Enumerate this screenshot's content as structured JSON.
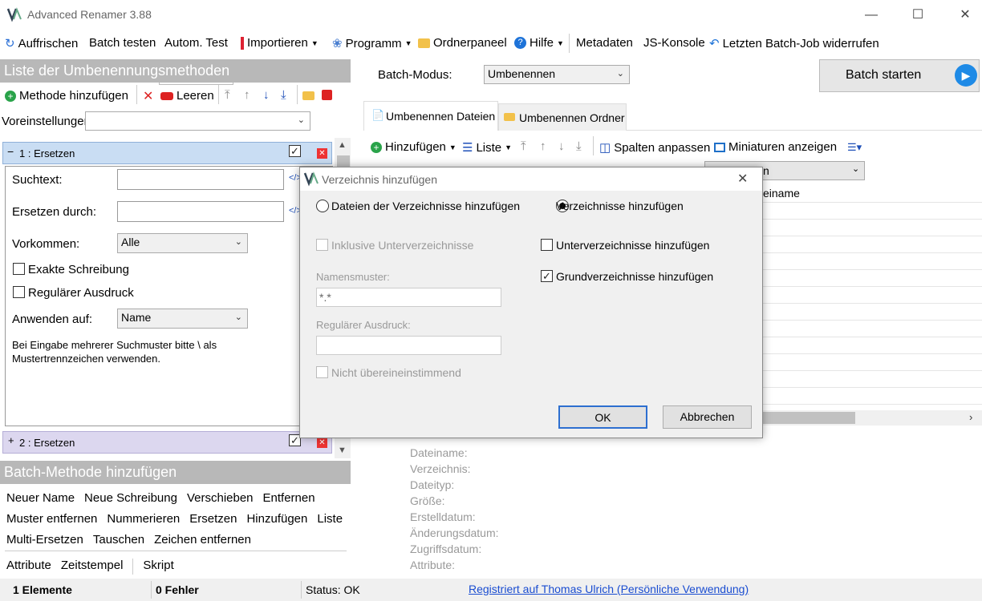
{
  "app": {
    "title": "Advanced Renamer 3.88"
  },
  "toolbar": {
    "refresh": "Auffrischen",
    "batch_test": "Batch testen",
    "auto_test": "Autom. Test",
    "import": "Importieren",
    "program": "Programm",
    "folder_panel": "Ordnerpaneel",
    "help": "Hilfe",
    "metadata": "Metadaten",
    "js_console": "JS-Konsole",
    "undo": "Letzten Batch-Job widerrufen"
  },
  "left": {
    "header": "Liste der Umbenennungsmethoden",
    "add_method": "Methode hinzufügen",
    "clear": "Leeren",
    "presets_label": "Voreinstellungen:",
    "presets_value": "",
    "method1": {
      "title": "1 : Ersetzen",
      "search_label": "Suchtext:",
      "replace_label": "Ersetzen durch:",
      "occurrence_label": "Vorkommen:",
      "occurrence_value": "Alle",
      "exact_label": "Exakte Schreibung",
      "regex_label": "Regulärer Ausdruck",
      "apply_label": "Anwenden auf:",
      "apply_value": "Name",
      "hint": "Bei Eingabe mehrerer Suchmuster bitte \\ als Mustertrennzeichen verwenden."
    },
    "method2": {
      "title": "2 : Ersetzen"
    },
    "add_header": "Batch-Methode hinzufügen",
    "methods_row1": [
      "Neuer Name",
      "Neue Schreibung",
      "Verschieben",
      "Entfernen"
    ],
    "methods_row2": [
      "Muster entfernen",
      "Nummerieren",
      "Ersetzen",
      "Hinzufügen",
      "Liste"
    ],
    "methods_row3": [
      "Multi-Ersetzen",
      "Tauschen",
      "Zeichen entfernen"
    ],
    "methods_row4": [
      "Attribute",
      "Zeitstempel",
      "Skript"
    ]
  },
  "right": {
    "batch_mode_label": "Batch-Modus:",
    "batch_mode_value": "Umbenennen",
    "start": "Batch starten",
    "tab_files": "Umbenennen Dateien",
    "tab_folders": "Umbenennen Ordner",
    "add": "Hinzufügen",
    "list": "Liste",
    "fit_columns": "Spalten anpassen",
    "thumbnails": "Miniaturen anzeigen",
    "col_frag1": "n",
    "col_frag2": "einame",
    "info": [
      "Dateiname:",
      "Verzeichnis:",
      "Dateityp:",
      "Größe:",
      "Erstelldatum:",
      "Änderungsdatum:",
      "Zugriffsdatum:",
      "Attribute:"
    ]
  },
  "dialog": {
    "title": "Verzeichnis hinzufügen",
    "opt_files": "Dateien der Verzeichnisse hinzufügen",
    "opt_dirs": "Verzeichnisse hinzufügen",
    "inc_sub": "Inklusive Unterverzeichnisse",
    "add_sub": "Unterverzeichnisse hinzufügen",
    "add_base": "Grundverzeichnisse hinzufügen",
    "pattern_label": "Namensmuster:",
    "pattern_value": "*.*",
    "regex_label": "Regulärer Ausdruck:",
    "regex_value": "",
    "not_match": "Nicht übereineinstimmend",
    "ok": "OK",
    "cancel": "Abbrechen"
  },
  "status": {
    "items": "1 Elemente",
    "errors": "0 Fehler",
    "state": "Status: OK",
    "registered": "Registriert auf Thomas Ulrich (Persönliche Verwendung)"
  }
}
